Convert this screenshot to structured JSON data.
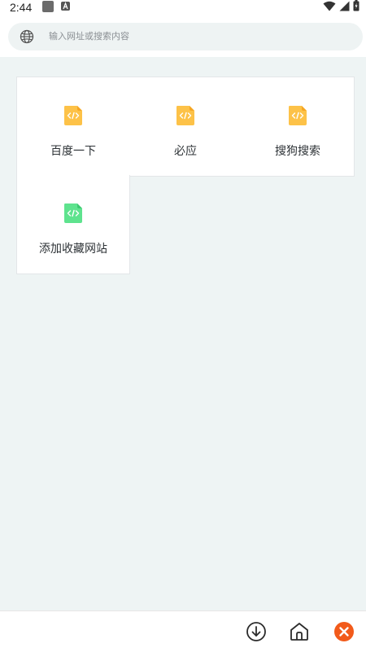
{
  "status_bar": {
    "time": "2:44",
    "icons": [
      "notification-icon",
      "a-icon",
      "wifi-icon",
      "signal-icon",
      "battery-icon"
    ]
  },
  "address_bar": {
    "placeholder": "输入网址或搜索内容",
    "icon": "globe-icon"
  },
  "bookmarks": [
    {
      "label": "百度一下",
      "icon": "code-file-icon",
      "color": "#FDC248"
    },
    {
      "label": "必应",
      "icon": "code-file-icon",
      "color": "#FDC248"
    },
    {
      "label": "搜狗搜索",
      "icon": "code-file-icon",
      "color": "#FDC248"
    },
    {
      "label": "添加收藏网站",
      "icon": "code-file-icon",
      "color": "#5EE38E"
    }
  ],
  "bottom_bar": {
    "buttons": [
      "download-icon",
      "home-icon",
      "close-icon"
    ]
  },
  "colors": {
    "accent_orange": "#F25A1A",
    "content_bg": "#EEF4F4",
    "bookmark_yellow": "#FDC248",
    "bookmark_green": "#5EE38E"
  }
}
